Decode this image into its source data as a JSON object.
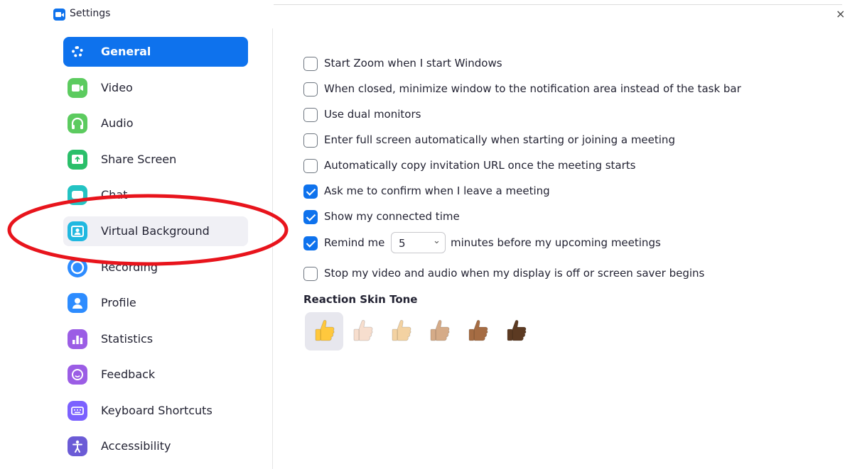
{
  "window": {
    "title": "Settings",
    "close_glyph": "×"
  },
  "sidebar": {
    "items": [
      {
        "label": "General",
        "icon": "gear-icon",
        "color": "#0e72ed",
        "active": true
      },
      {
        "label": "Video",
        "icon": "video-icon",
        "color": "#5ccb5f"
      },
      {
        "label": "Audio",
        "icon": "headphones-icon",
        "color": "#5ccb5f"
      },
      {
        "label": "Share Screen",
        "icon": "share-screen-icon",
        "color": "#2bbf6a"
      },
      {
        "label": "Chat",
        "icon": "chat-icon",
        "color": "#23c3c3"
      },
      {
        "label": "Virtual Background",
        "icon": "virtual-background-icon",
        "color": "#20b8e0",
        "highlighted": true
      },
      {
        "label": "Recording",
        "icon": "recording-icon",
        "color": "#2d8cff"
      },
      {
        "label": "Profile",
        "icon": "profile-icon",
        "color": "#2d8cff"
      },
      {
        "label": "Statistics",
        "icon": "statistics-icon",
        "color": "#9b5de5"
      },
      {
        "label": "Feedback",
        "icon": "feedback-icon",
        "color": "#9b5de5"
      },
      {
        "label": "Keyboard Shortcuts",
        "icon": "keyboard-icon",
        "color": "#7b61ff"
      },
      {
        "label": "Accessibility",
        "icon": "accessibility-icon",
        "color": "#6b5bd6"
      }
    ]
  },
  "general": {
    "options": [
      {
        "label": "Start Zoom when I start Windows",
        "checked": false
      },
      {
        "label": "When closed, minimize window to the notification area instead of the task bar",
        "checked": false
      },
      {
        "label": "Use dual monitors",
        "checked": false
      },
      {
        "label": "Enter full screen automatically when starting or joining a meeting",
        "checked": false
      },
      {
        "label": "Automatically copy invitation URL once the meeting starts",
        "checked": false
      },
      {
        "label": "Ask me to confirm when I leave a meeting",
        "checked": true
      },
      {
        "label": "Show my connected time",
        "checked": true
      }
    ],
    "remind": {
      "checked": true,
      "label_before": "Remind me",
      "minutes_value": "5",
      "label_after": "minutes before my upcoming meetings"
    },
    "stop_video": {
      "label": "Stop my video and audio when my display is off or screen saver begins",
      "checked": false
    },
    "reaction": {
      "title": "Reaction Skin Tone",
      "tones": [
        "#ffc83d",
        "#f7dece",
        "#f3d2a2",
        "#d5ab88",
        "#a56c43",
        "#5c3a22"
      ],
      "selected_index": 0
    }
  },
  "annotation": {
    "color": "#e8141c"
  }
}
